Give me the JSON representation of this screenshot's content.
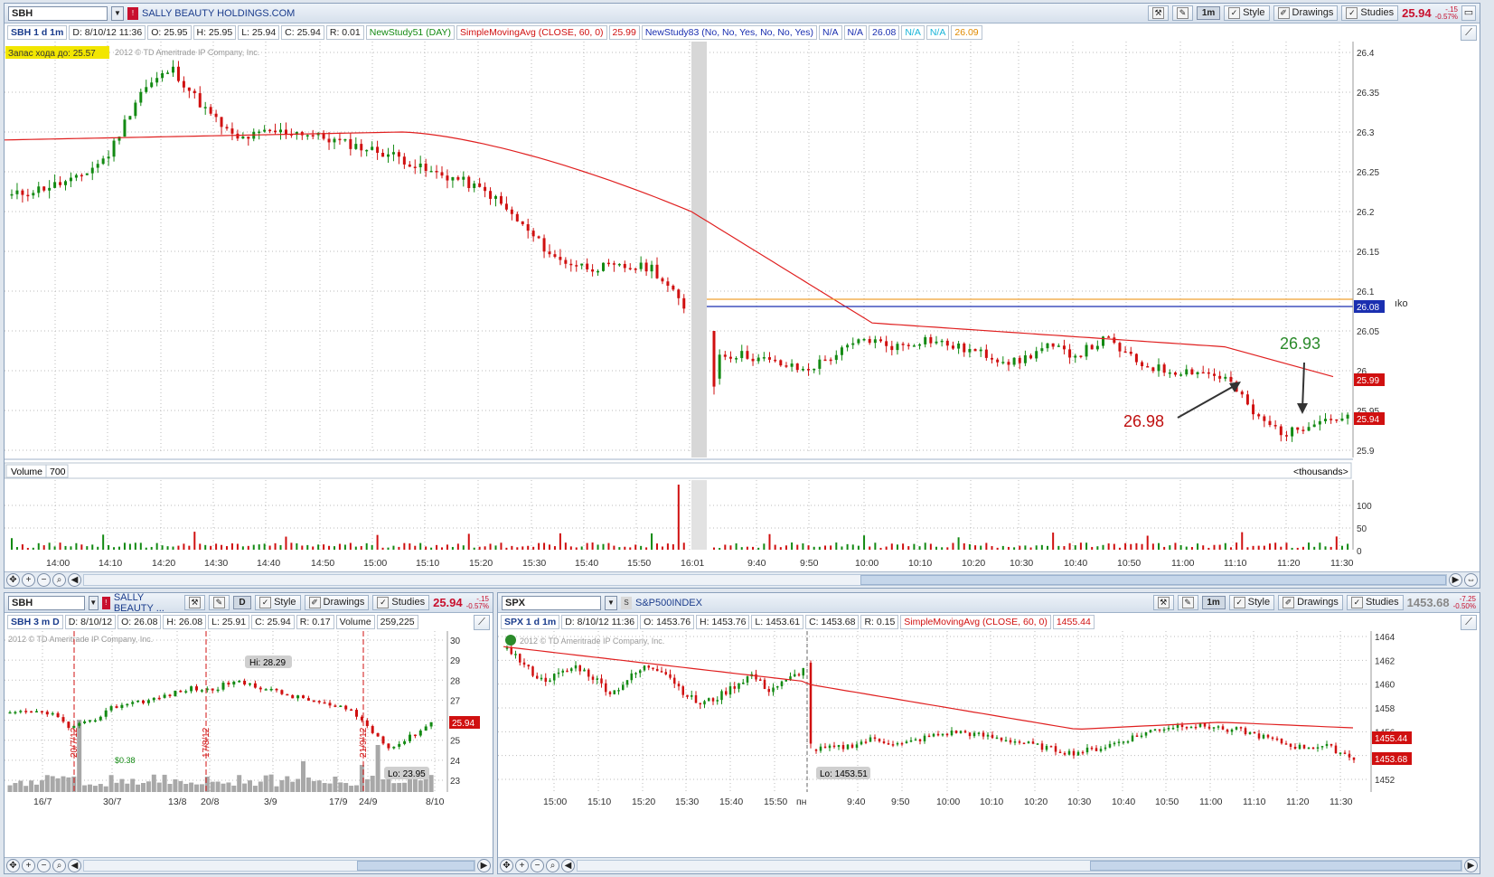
{
  "main": {
    "symbol": "SBH",
    "company": "SALLY BEAUTY HOLDINGS.COM",
    "agg": "1m",
    "style": "Style",
    "drawings": "Drawings",
    "studies": "Studies",
    "last": "25.94",
    "chg1": "-.15",
    "chg2": "-0.57%",
    "info": {
      "title": "SBH 1 d 1m",
      "d": "D: 8/10/12 11:36",
      "o": "O: 25.95",
      "h": "H: 25.95",
      "l": "L: 25.94",
      "c": "C: 25.94",
      "r": "R: 0.01",
      "ns51": "NewStudy51 (DAY)",
      "sma": "SimpleMovingAvg (CLOSE, 60, 0)",
      "sma_val": "25.99",
      "ns83": "NewStudy83 (No, No, Yes, No, No, Yes)",
      "na1": "N/A",
      "na2": "N/A",
      "v1": "26.08",
      "na3": "N/A",
      "na4": "N/A",
      "v2": "26.09"
    },
    "zapas": "Запас хода до: 25.57",
    "copyright": "2012 © TD Ameritrade IP Company, Inc.",
    "yticks": [
      "26.4",
      "26.35",
      "26.3",
      "26.25",
      "26.2",
      "26.15",
      "26.1",
      "26.05",
      "26",
      "25.95",
      "25.9"
    ],
    "tag_blue": "26.08",
    "tag_sma": "25.99",
    "tag_last": "25.94",
    "ann1": "26.93",
    "ann2": "26.98",
    "volume_label": "Volume",
    "volume_val": "700",
    "thousands": "<thousands>",
    "vticks": [
      "100",
      "50",
      "0"
    ],
    "xticks": [
      "14:00",
      "14:10",
      "14:20",
      "14:30",
      "14:40",
      "14:50",
      "15:00",
      "15:10",
      "15:20",
      "15:30",
      "15:40",
      "15:50",
      "16:01",
      "9:40",
      "9:50",
      "10:00",
      "10:10",
      "10:20",
      "10:30",
      "10:40",
      "10:50",
      "11:00",
      "11:10",
      "11:20",
      "11:30"
    ],
    "edge_text": "ıko"
  },
  "left": {
    "symbol": "SBH",
    "company": "SALLY BEAUTY ...",
    "agg": "D",
    "style": "Style",
    "drawings": "Drawings",
    "studies": "Studies",
    "last": "25.94",
    "chg1": "-.15",
    "chg2": "-0.57%",
    "info": {
      "title": "SBH 3 m D",
      "d": "D: 8/10/12",
      "o": "O: 26.08",
      "h": "H: 26.08",
      "l": "L: 25.91",
      "c": "C: 25.94",
      "r": "R: 0.17",
      "vol": "Volume",
      "volv": "259,225"
    },
    "copyright": "2012 © TD Ameritrade IP Company, Inc.",
    "hi": "Hi: 28.29",
    "lo": "Lo: 23.95",
    "div": "$0.38",
    "yticks": [
      "30",
      "29",
      "28",
      "27",
      "26",
      "25",
      "24",
      "23"
    ],
    "tag_last": "25.94",
    "dates": [
      "20/7/12",
      "17/8/12",
      "21/9/12"
    ],
    "xticks": [
      "16/7",
      "30/7",
      "13/8",
      "20/8",
      "3/9",
      "17/9",
      "24/9",
      "8/10"
    ]
  },
  "right": {
    "symbol": "SPX",
    "company": "S&P500INDEX",
    "agg": "1m",
    "style": "Style",
    "drawings": "Drawings",
    "studies": "Studies",
    "last": "1453.68",
    "chg1": "-7.25",
    "chg2": "-0.50%",
    "info": {
      "title": "SPX 1 d 1m",
      "d": "D: 8/10/12 11:36",
      "o": "O: 1453.76",
      "h": "H: 1453.76",
      "l": "L: 1453.61",
      "c": "C: 1453.68",
      "r": "R: 0.15",
      "sma": "SimpleMovingAvg (CLOSE, 60, 0)",
      "sma_val": "1455.44"
    },
    "copyright": "2012 © TD Ameritrade IP Company, Inc.",
    "lo": "Lo: 1453.51",
    "yticks": [
      "1464",
      "1462",
      "1460",
      "1458",
      "1456",
      "1454",
      "1452"
    ],
    "tag_sma": "1455.44",
    "tag_last": "1453.68",
    "xticks": [
      "15:00",
      "15:10",
      "15:20",
      "15:30",
      "15:40",
      "15:50",
      "пн",
      "9:40",
      "9:50",
      "10:00",
      "10:10",
      "10:20",
      "10:30",
      "10:40",
      "10:50",
      "11:00",
      "11:10",
      "11:20",
      "11:30"
    ]
  },
  "colors": {
    "up": "#138a13",
    "down": "#d01010",
    "sma": "#e02020",
    "blue": "#1a2fb0",
    "orange": "#f0a030"
  }
}
